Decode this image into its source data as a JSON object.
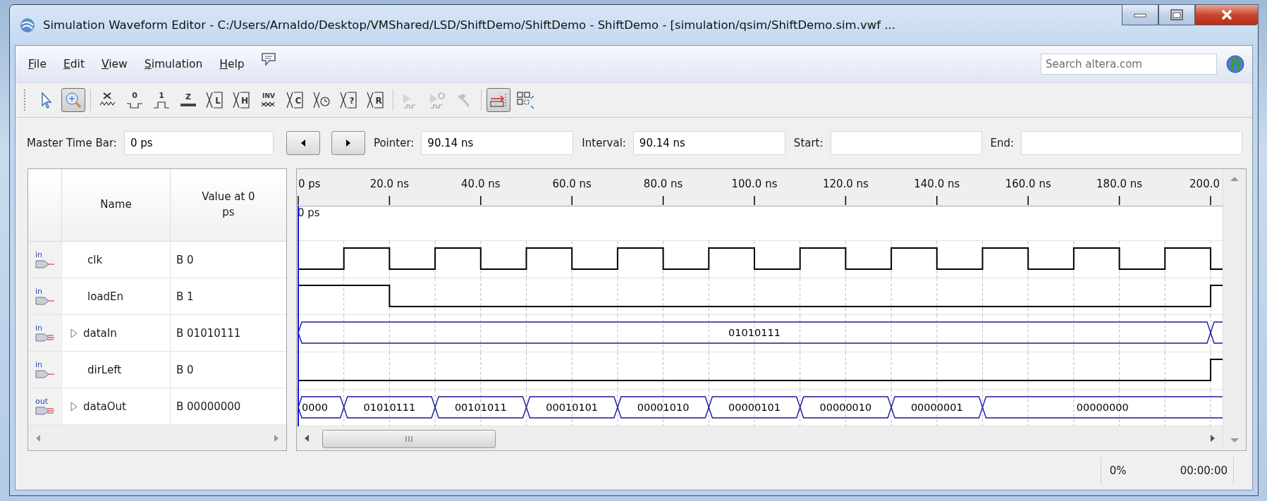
{
  "window": {
    "title": "Simulation Waveform Editor - C:/Users/Arnaldo/Desktop/VMShared/LSD/ShiftDemo/ShiftDemo - ShiftDemo - [simulation/qsim/ShiftDemo.sim.vwf ..."
  },
  "menu": [
    "File",
    "Edit",
    "View",
    "Simulation",
    "Help"
  ],
  "search": {
    "placeholder": "Search altera.com"
  },
  "toolbar": [
    {
      "kind": "grip"
    },
    {
      "kind": "pointer",
      "pressed": false,
      "disabled": false
    },
    {
      "kind": "zoom",
      "pressed": true,
      "disabled": false
    },
    {
      "kind": "separator"
    },
    {
      "kind": "uninit",
      "pressed": false,
      "disabled": false
    },
    {
      "kind": "low",
      "label": "0",
      "pressed": false,
      "disabled": false
    },
    {
      "kind": "high",
      "label": "1",
      "pressed": false,
      "disabled": false
    },
    {
      "kind": "z",
      "label": "Z",
      "pressed": false,
      "disabled": false
    },
    {
      "kind": "value",
      "label": "L",
      "pressed": false,
      "disabled": false
    },
    {
      "kind": "value",
      "label": "H",
      "pressed": false,
      "disabled": false
    },
    {
      "kind": "invert",
      "label": "INV",
      "pressed": false,
      "disabled": false
    },
    {
      "kind": "value",
      "label": "C",
      "pressed": false,
      "disabled": false
    },
    {
      "kind": "clock",
      "pressed": false,
      "disabled": false
    },
    {
      "kind": "value",
      "label": "?",
      "pressed": false,
      "disabled": false
    },
    {
      "kind": "value",
      "label": "R",
      "pressed": false,
      "disabled": false
    },
    {
      "kind": "separator"
    },
    {
      "kind": "run",
      "pressed": false,
      "disabled": true
    },
    {
      "kind": "run-timing",
      "pressed": false,
      "disabled": true
    },
    {
      "kind": "hammer",
      "pressed": false,
      "disabled": true
    },
    {
      "kind": "separator"
    },
    {
      "kind": "snap",
      "pressed": true,
      "disabled": false
    },
    {
      "kind": "grid",
      "pressed": false,
      "disabled": false
    }
  ],
  "time_bar": {
    "master_label": "Master Time Bar:",
    "master_value": "0 ps",
    "pointer_label": "Pointer:",
    "pointer_value": "90.14 ns",
    "interval_label": "Interval:",
    "interval_value": "90.14 ns",
    "start_label": "Start:",
    "end_label": "End:"
  },
  "table": {
    "columns": [
      "Name",
      "Value at 0 ps"
    ]
  },
  "ruler": {
    "ticks": [
      "0 ps",
      "20.0 ns",
      "40.0 ns",
      "60.0 ns",
      "80.0 ns",
      "100.0 ns",
      "120.0 ns",
      "140.0 ns",
      "160.0 ns",
      "180.0 ns",
      "200.0"
    ],
    "marker": "0 ps"
  },
  "signals": [
    {
      "direction": "in",
      "name": "clk",
      "value": "B 0",
      "kind": "clock"
    },
    {
      "direction": "in",
      "name": "loadEn",
      "value": "B 1",
      "kind": "bit"
    },
    {
      "direction": "in",
      "name": "dataIn",
      "value": "B 01010111",
      "kind": "bus",
      "segments": [
        "01010111"
      ]
    },
    {
      "direction": "in",
      "name": "dirLeft",
      "value": "B 0",
      "kind": "bit"
    },
    {
      "direction": "out",
      "name": "dataOut",
      "value": "B 00000000",
      "kind": "bus",
      "segments": [
        "0000",
        "01010111",
        "00101011",
        "00010101",
        "00001010",
        "00000101",
        "00000010",
        "00000001",
        "00000000"
      ]
    }
  ],
  "status": {
    "progress": "0%",
    "elapsed": "00:00:00"
  }
}
